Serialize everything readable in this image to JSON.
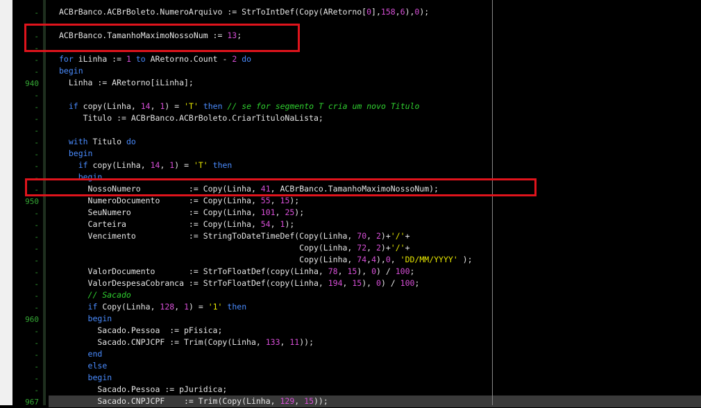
{
  "editor": {
    "lines": [
      {
        "num": "-",
        "tokens": [
          {
            "t": "ACBrBanco.ACBrBoleto.NumeroArquivo := StrToIntDef(Copy(ARetorno[",
            "c": "plain"
          },
          {
            "t": "0",
            "c": "num"
          },
          {
            "t": "],",
            "c": "plain"
          },
          {
            "t": "158",
            "c": "num"
          },
          {
            "t": ",",
            "c": "plain"
          },
          {
            "t": "6",
            "c": "num"
          },
          {
            "t": "),",
            "c": "plain"
          },
          {
            "t": "0",
            "c": "num"
          },
          {
            "t": ");",
            "c": "plain"
          }
        ]
      },
      {
        "num": "-",
        "tokens": []
      },
      {
        "num": "-",
        "tokens": [
          {
            "t": "ACBrBanco.TamanhoMaximoNossoNum := ",
            "c": "plain"
          },
          {
            "t": "13",
            "c": "num"
          },
          {
            "t": ";",
            "c": "plain"
          }
        ]
      },
      {
        "num": "-",
        "tokens": []
      },
      {
        "num": "-",
        "tokens": [
          {
            "t": "for",
            "c": "kw"
          },
          {
            "t": " iLinha := ",
            "c": "plain"
          },
          {
            "t": "1",
            "c": "num"
          },
          {
            "t": " ",
            "c": "plain"
          },
          {
            "t": "to",
            "c": "kw"
          },
          {
            "t": " ARetorno.Count - ",
            "c": "plain"
          },
          {
            "t": "2",
            "c": "num"
          },
          {
            "t": " ",
            "c": "plain"
          },
          {
            "t": "do",
            "c": "kw"
          }
        ]
      },
      {
        "num": "-",
        "tokens": [
          {
            "t": "begin",
            "c": "kw"
          }
        ]
      },
      {
        "num": "940",
        "tokens": [
          {
            "t": "  Linha := ARetorno[iLinha];",
            "c": "plain"
          }
        ]
      },
      {
        "num": "-",
        "tokens": []
      },
      {
        "num": "-",
        "tokens": [
          {
            "t": "  ",
            "c": "plain"
          },
          {
            "t": "if",
            "c": "kw"
          },
          {
            "t": " copy(Linha, ",
            "c": "plain"
          },
          {
            "t": "14",
            "c": "num"
          },
          {
            "t": ", ",
            "c": "plain"
          },
          {
            "t": "1",
            "c": "num"
          },
          {
            "t": ") = ",
            "c": "plain"
          },
          {
            "t": "'T'",
            "c": "str"
          },
          {
            "t": " ",
            "c": "plain"
          },
          {
            "t": "then",
            "c": "kw"
          },
          {
            "t": " ",
            "c": "plain"
          },
          {
            "t": "// se for segmento T cria um novo Titulo",
            "c": "com"
          }
        ]
      },
      {
        "num": "-",
        "tokens": [
          {
            "t": "     Titulo := ACBrBanco.ACBrBoleto.CriarTituloNaLista;",
            "c": "plain"
          }
        ]
      },
      {
        "num": "-",
        "tokens": []
      },
      {
        "num": "-",
        "tokens": [
          {
            "t": "  ",
            "c": "plain"
          },
          {
            "t": "with",
            "c": "kw"
          },
          {
            "t": " Titulo ",
            "c": "plain"
          },
          {
            "t": "do",
            "c": "kw"
          }
        ]
      },
      {
        "num": "-",
        "tokens": [
          {
            "t": "  ",
            "c": "plain"
          },
          {
            "t": "begin",
            "c": "kw"
          }
        ]
      },
      {
        "num": "-",
        "tokens": [
          {
            "t": "    ",
            "c": "plain"
          },
          {
            "t": "if",
            "c": "kw"
          },
          {
            "t": " copy(Linha, ",
            "c": "plain"
          },
          {
            "t": "14",
            "c": "num"
          },
          {
            "t": ", ",
            "c": "plain"
          },
          {
            "t": "1",
            "c": "num"
          },
          {
            "t": ") = ",
            "c": "plain"
          },
          {
            "t": "'T'",
            "c": "str"
          },
          {
            "t": " ",
            "c": "plain"
          },
          {
            "t": "then",
            "c": "kw"
          }
        ]
      },
      {
        "num": "-",
        "tokens": [
          {
            "t": "    begin",
            "c": "kw"
          }
        ]
      },
      {
        "num": "-",
        "tokens": [
          {
            "t": "      NossoNumero          := Copy(Linha, ",
            "c": "plain"
          },
          {
            "t": "41",
            "c": "num"
          },
          {
            "t": ", ACBrBanco.TamanhoMaximoNossoNum);",
            "c": "plain"
          }
        ]
      },
      {
        "num": "950",
        "tokens": [
          {
            "t": "      NumeroDocumento      := Copy(Linha, ",
            "c": "plain"
          },
          {
            "t": "55",
            "c": "num"
          },
          {
            "t": ", ",
            "c": "plain"
          },
          {
            "t": "15",
            "c": "num"
          },
          {
            "t": ");",
            "c": "plain"
          }
        ]
      },
      {
        "num": "-",
        "tokens": [
          {
            "t": "      SeuNumero            := Copy(Linha, ",
            "c": "plain"
          },
          {
            "t": "101",
            "c": "num"
          },
          {
            "t": ", ",
            "c": "plain"
          },
          {
            "t": "25",
            "c": "num"
          },
          {
            "t": ");",
            "c": "plain"
          }
        ]
      },
      {
        "num": "-",
        "tokens": [
          {
            "t": "      Carteira             := Copy(Linha, ",
            "c": "plain"
          },
          {
            "t": "54",
            "c": "num"
          },
          {
            "t": ", ",
            "c": "plain"
          },
          {
            "t": "1",
            "c": "num"
          },
          {
            "t": ");",
            "c": "plain"
          }
        ]
      },
      {
        "num": "-",
        "tokens": [
          {
            "t": "      Vencimento           := StringToDateTimeDef(Copy(Linha, ",
            "c": "plain"
          },
          {
            "t": "70",
            "c": "num"
          },
          {
            "t": ", ",
            "c": "plain"
          },
          {
            "t": "2",
            "c": "num"
          },
          {
            "t": ")+",
            "c": "plain"
          },
          {
            "t": "'/'",
            "c": "str"
          },
          {
            "t": "+",
            "c": "plain"
          }
        ]
      },
      {
        "num": "-",
        "tokens": [
          {
            "t": "                                                  Copy(Linha, ",
            "c": "plain"
          },
          {
            "t": "72",
            "c": "num"
          },
          {
            "t": ", ",
            "c": "plain"
          },
          {
            "t": "2",
            "c": "num"
          },
          {
            "t": ")+",
            "c": "plain"
          },
          {
            "t": "'/'",
            "c": "str"
          },
          {
            "t": "+",
            "c": "plain"
          }
        ]
      },
      {
        "num": "-",
        "tokens": [
          {
            "t": "                                                  Copy(Linha, ",
            "c": "plain"
          },
          {
            "t": "74",
            "c": "num"
          },
          {
            "t": ",",
            "c": "plain"
          },
          {
            "t": "4",
            "c": "num"
          },
          {
            "t": "),",
            "c": "plain"
          },
          {
            "t": "0",
            "c": "num"
          },
          {
            "t": ", ",
            "c": "plain"
          },
          {
            "t": "'DD/MM/YYYY'",
            "c": "str"
          },
          {
            "t": " );",
            "c": "plain"
          }
        ]
      },
      {
        "num": "-",
        "tokens": [
          {
            "t": "      ValorDocumento       := StrToFloatDef(copy(Linha, ",
            "c": "plain"
          },
          {
            "t": "78",
            "c": "num"
          },
          {
            "t": ", ",
            "c": "plain"
          },
          {
            "t": "15",
            "c": "num"
          },
          {
            "t": "), ",
            "c": "plain"
          },
          {
            "t": "0",
            "c": "num"
          },
          {
            "t": ") / ",
            "c": "plain"
          },
          {
            "t": "100",
            "c": "num"
          },
          {
            "t": ";",
            "c": "plain"
          }
        ]
      },
      {
        "num": "-",
        "tokens": [
          {
            "t": "      ValorDespesaCobranca := StrToFloatDef(copy(Linha, ",
            "c": "plain"
          },
          {
            "t": "194",
            "c": "num"
          },
          {
            "t": ", ",
            "c": "plain"
          },
          {
            "t": "15",
            "c": "num"
          },
          {
            "t": "), ",
            "c": "plain"
          },
          {
            "t": "0",
            "c": "num"
          },
          {
            "t": ") / ",
            "c": "plain"
          },
          {
            "t": "100",
            "c": "num"
          },
          {
            "t": ";",
            "c": "plain"
          }
        ]
      },
      {
        "num": "-",
        "tokens": [
          {
            "t": "      ",
            "c": "plain"
          },
          {
            "t": "// Sacado",
            "c": "com"
          }
        ]
      },
      {
        "num": "-",
        "tokens": [
          {
            "t": "      ",
            "c": "plain"
          },
          {
            "t": "if",
            "c": "kw"
          },
          {
            "t": " Copy(Linha, ",
            "c": "plain"
          },
          {
            "t": "128",
            "c": "num"
          },
          {
            "t": ", ",
            "c": "plain"
          },
          {
            "t": "1",
            "c": "num"
          },
          {
            "t": ") = ",
            "c": "plain"
          },
          {
            "t": "'1'",
            "c": "str"
          },
          {
            "t": " ",
            "c": "plain"
          },
          {
            "t": "then",
            "c": "kw"
          }
        ]
      },
      {
        "num": "960",
        "tokens": [
          {
            "t": "      ",
            "c": "plain"
          },
          {
            "t": "begin",
            "c": "kw"
          }
        ]
      },
      {
        "num": "-",
        "tokens": [
          {
            "t": "        Sacado.Pessoa  := pFisica;",
            "c": "plain"
          }
        ]
      },
      {
        "num": "-",
        "tokens": [
          {
            "t": "        Sacado.CNPJCPF := Trim(Copy(Linha, ",
            "c": "plain"
          },
          {
            "t": "133",
            "c": "num"
          },
          {
            "t": ", ",
            "c": "plain"
          },
          {
            "t": "11",
            "c": "num"
          },
          {
            "t": "));",
            "c": "plain"
          }
        ]
      },
      {
        "num": "-",
        "tokens": [
          {
            "t": "      ",
            "c": "plain"
          },
          {
            "t": "end",
            "c": "kw"
          }
        ]
      },
      {
        "num": "-",
        "tokens": [
          {
            "t": "      ",
            "c": "plain"
          },
          {
            "t": "else",
            "c": "kw"
          }
        ]
      },
      {
        "num": "-",
        "tokens": [
          {
            "t": "      ",
            "c": "plain"
          },
          {
            "t": "begin",
            "c": "kw"
          }
        ]
      },
      {
        "num": "-",
        "tokens": [
          {
            "t": "        Sacado.Pessoa := pJuridica;",
            "c": "plain"
          }
        ]
      },
      {
        "num": "967",
        "tokens": [
          {
            "t": "        Sacado.CNPJCPF    := Trim(Copy(Linha, ",
            "c": "plain"
          },
          {
            "t": "129",
            "c": "num"
          },
          {
            "t": ", ",
            "c": "plain"
          },
          {
            "t": "15",
            "c": "num"
          },
          {
            "t": "));",
            "c": "plain"
          }
        ]
      }
    ]
  },
  "colors": {
    "keyword": "#4a8cff",
    "number": "#d84fd8",
    "string": "#e6e600",
    "comment": "#2fcf2f",
    "text": "#e6e6e6",
    "line_number": "#35a835",
    "highlight_box": "#e0141c"
  }
}
